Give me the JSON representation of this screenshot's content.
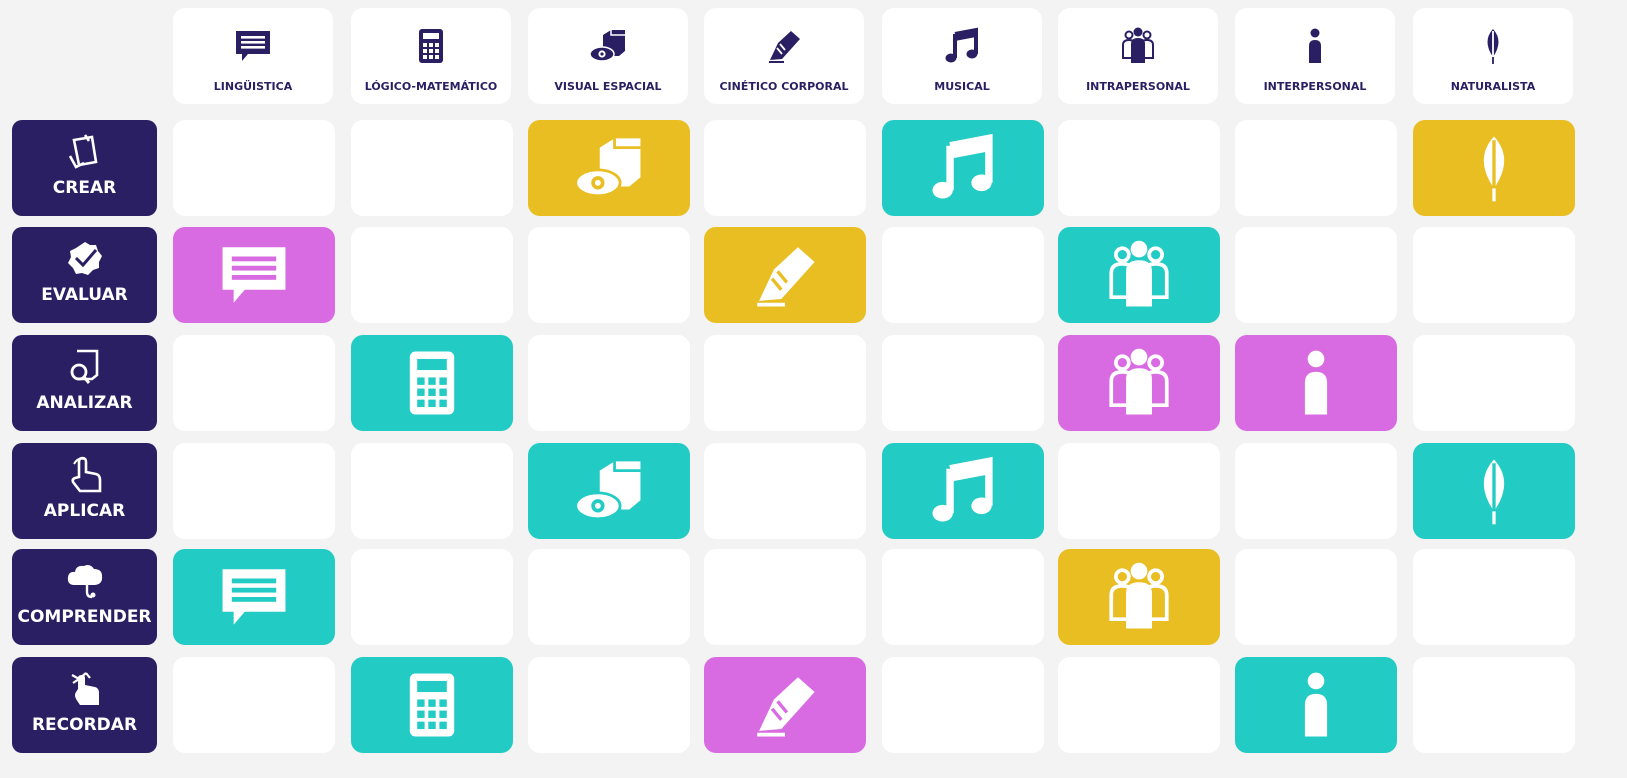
{
  "colors": {
    "navy": "#2a1f63",
    "yellow": "#e8be22",
    "teal": "#22cbc3",
    "pink": "#d96be2",
    "empty": "#ffffff",
    "background": "#f3f3f3"
  },
  "columns": [
    {
      "label": "LINGÜISTICA",
      "icon": "speech-bubble-icon"
    },
    {
      "label": "LÓGICO-MATEMÁTICO",
      "icon": "calculator-icon"
    },
    {
      "label": "VISUAL ESPACIAL",
      "icon": "eye-cube-icon"
    },
    {
      "label": "CINÉTICO CORPORAL",
      "icon": "shoe-icon"
    },
    {
      "label": "MUSICAL",
      "icon": "music-note-icon"
    },
    {
      "label": "INTRAPERSONAL",
      "icon": "group-icon"
    },
    {
      "label": "INTERPERSONAL",
      "icon": "person-icon"
    },
    {
      "label": "NATURALISTA",
      "icon": "leaf-icon"
    }
  ],
  "rows": [
    {
      "label": "CREAR",
      "icon": "create-icon",
      "cells": [
        null,
        null,
        "yellow",
        null,
        "teal",
        null,
        null,
        "yellow"
      ]
    },
    {
      "label": "EVALUAR",
      "icon": "check-badge-icon",
      "cells": [
        "pink",
        null,
        null,
        "yellow",
        null,
        "teal",
        null,
        null
      ]
    },
    {
      "label": "ANALIZAR",
      "icon": "analyze-icon",
      "cells": [
        null,
        "teal",
        null,
        null,
        null,
        "pink",
        "pink",
        null
      ]
    },
    {
      "label": "APLICAR",
      "icon": "hand-pointer-icon",
      "cells": [
        null,
        null,
        "teal",
        null,
        "teal",
        null,
        null,
        "teal"
      ]
    },
    {
      "label": "COMPRENDER",
      "icon": "brain-cloud-icon",
      "cells": [
        "teal",
        null,
        null,
        null,
        null,
        "yellow",
        null,
        null
      ]
    },
    {
      "label": "RECORDAR",
      "icon": "finger-ribbon-icon",
      "cells": [
        null,
        "teal",
        null,
        "pink",
        null,
        null,
        "teal",
        null
      ]
    }
  ]
}
